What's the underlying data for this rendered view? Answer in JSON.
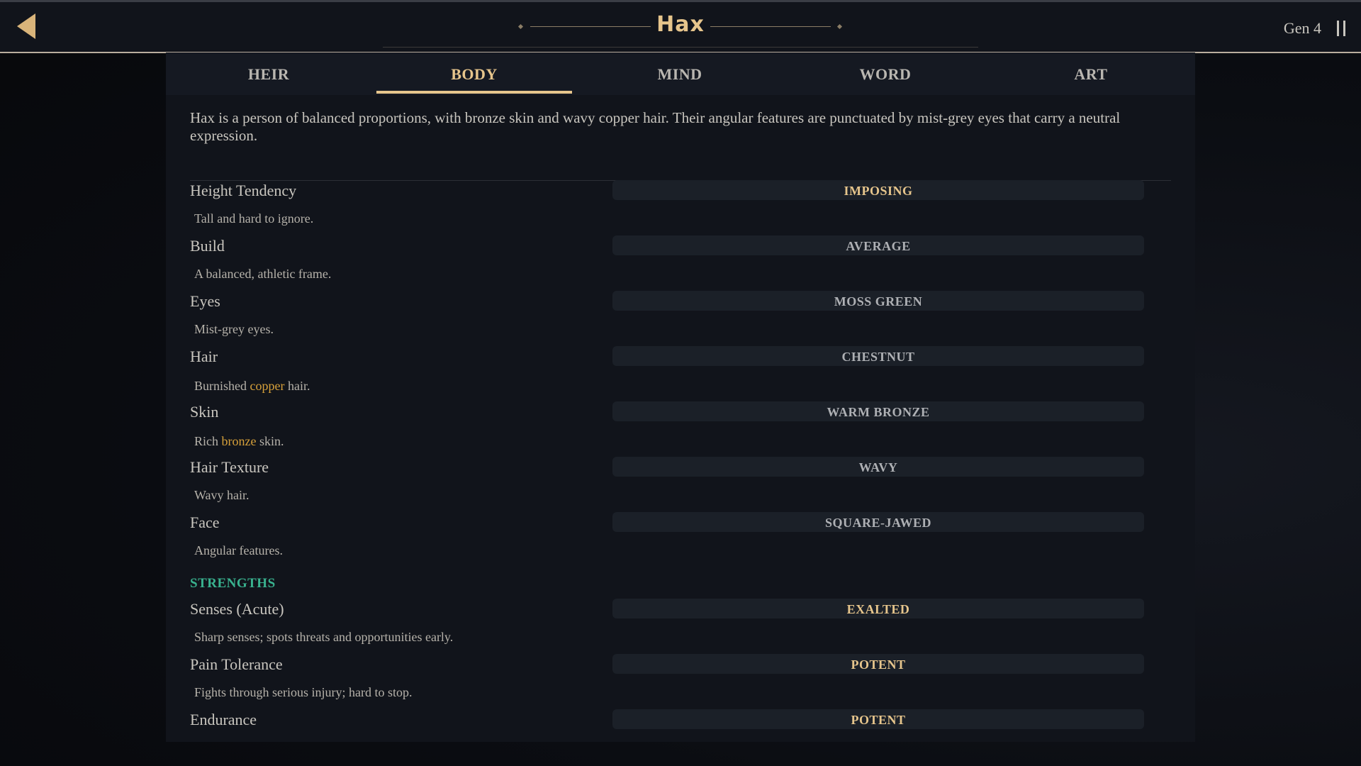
{
  "header": {
    "title": "Hax",
    "generation": "Gen 4"
  },
  "tabs": [
    "HEIR",
    "BODY",
    "MIND",
    "WORD",
    "ART"
  ],
  "active_tab": "BODY",
  "description": "Hax is a person of balanced proportions, with bronze skin and wavy copper hair. Their angular features are punctuated by mist-grey eyes that carry a neutral expression.",
  "traits": [
    {
      "label": "Height Tendency",
      "value": "IMPOSING",
      "desc": "Tall and hard to ignore."
    },
    {
      "label": "Build",
      "value": "AVERAGE",
      "desc": "A balanced, athletic frame."
    },
    {
      "label": "Eyes",
      "value": "MOSS GREEN",
      "desc": "Mist-grey eyes."
    },
    {
      "label": "Hair",
      "value": "CHESTNUT",
      "desc_pre": "Burnished",
      "desc_highlight": "copper",
      "desc_post": "hair."
    },
    {
      "label": "Skin",
      "value": "WARM BRONZE",
      "desc_pre": "Rich",
      "desc_highlight": "bronze",
      "desc_post": "skin."
    },
    {
      "label": "Hair Texture",
      "value": "WAVY",
      "desc": "Wavy hair."
    },
    {
      "label": "Face",
      "value": "SQUARE-JAWED",
      "desc": "Angular features."
    }
  ],
  "strengths_heading": "STRENGTHS",
  "strengths": [
    {
      "label": "Senses (Acute)",
      "value": "EXALTED",
      "desc": "Sharp senses; spots threats and opportunities early."
    },
    {
      "label": "Pain Tolerance",
      "value": "POTENT",
      "desc": "Fights through serious injury; hard to stop."
    },
    {
      "label": "Endurance",
      "value": "POTENT"
    }
  ],
  "icons": {
    "back": "back-arrow-icon",
    "pause": "pause-icon"
  },
  "colors": {
    "accent": "#e6c58c",
    "strengths": "#39b28f",
    "highlight": "#d6a03a"
  }
}
